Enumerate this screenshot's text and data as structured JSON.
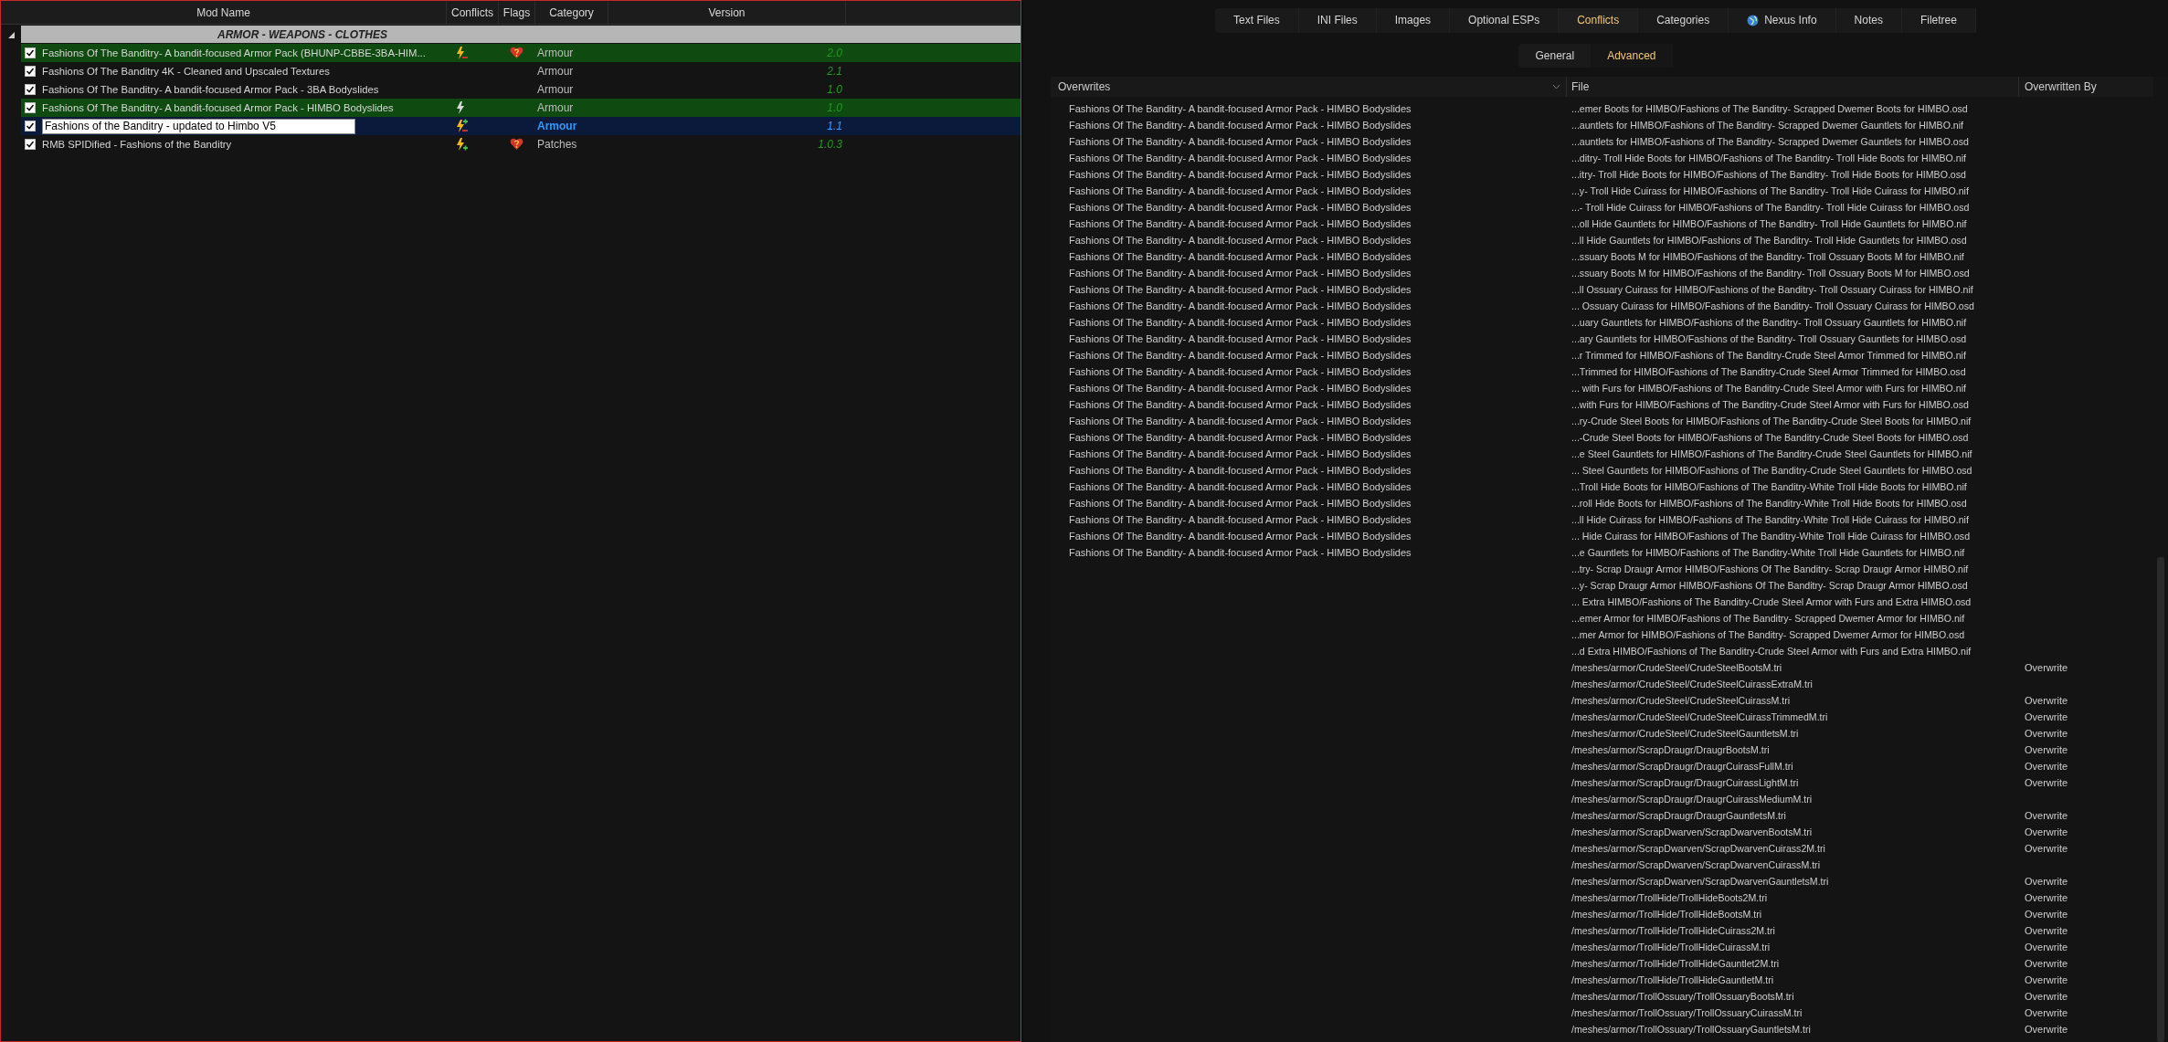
{
  "mod_list": {
    "columns": [
      "Mod Name",
      "Conflicts",
      "Flags",
      "Category",
      "Version"
    ],
    "group": {
      "label": "ARMOR - WEAPONS - CLOTHES",
      "expanded": true
    },
    "mods": [
      {
        "enabled": true,
        "name": "Fashions Of The Banditry- A bandit-focused Armor Pack (BHUNP-CBBE-3BA-HIM...",
        "overwrites": false,
        "overwritten": true,
        "redundant": false,
        "flagged": true,
        "category": "Armour",
        "version": "2.0",
        "highlighted": true,
        "selected": false,
        "editing": false
      },
      {
        "enabled": true,
        "name": "Fashions Of The Banditry 4K - Cleaned and Upscaled Textures",
        "category": "Armour",
        "version": "2.1",
        "highlighted": false,
        "selected": false,
        "editing": false
      },
      {
        "enabled": true,
        "name": "Fashions Of The Banditry- A bandit-focused Armor Pack - 3BA Bodyslides",
        "category": "Armour",
        "version": "1.0",
        "highlighted": false,
        "selected": false,
        "editing": false
      },
      {
        "enabled": true,
        "name": "Fashions Of The Banditry- A bandit-focused Armor Pack - HIMBO Bodyslides",
        "overwrites": false,
        "overwritten": false,
        "redundant": true,
        "category": "Armour",
        "version": "1.0",
        "highlighted": true,
        "selected": false,
        "editing": false
      },
      {
        "enabled": true,
        "name": "Fashions of the Banditry - updated to Himbo V5",
        "overwrites": true,
        "overwritten": true,
        "redundant": false,
        "category": "Armour",
        "version": "1.1",
        "highlighted": false,
        "selected": true,
        "editing": true
      },
      {
        "enabled": true,
        "name": "RMB SPIDified - Fashions of the Banditry",
        "overwrites": true,
        "overwritten": false,
        "redundant": false,
        "flagged": true,
        "category": "Patches",
        "version": "1.0.3",
        "highlighted": false,
        "selected": false,
        "editing": false
      }
    ]
  },
  "tabs": [
    {
      "label": "Text Files",
      "selected": false
    },
    {
      "label": "INI Files",
      "selected": false
    },
    {
      "label": "Images",
      "selected": false
    },
    {
      "label": "Optional ESPs",
      "selected": false
    },
    {
      "label": "Conflicts",
      "selected": true
    },
    {
      "label": "Categories",
      "selected": false
    },
    {
      "label": "Nexus Info",
      "selected": false,
      "kind": "globe"
    },
    {
      "label": "Notes",
      "selected": false
    },
    {
      "label": "Filetree",
      "selected": false
    }
  ],
  "subtabs": [
    {
      "label": "General",
      "selected": false
    },
    {
      "label": "Advanced",
      "selected": true
    }
  ],
  "conflicts_table": {
    "columns": [
      "Overwrites",
      "File",
      "Overwritten By"
    ],
    "rows": [
      {
        "overwrites": "Fashions Of The Banditry- A bandit-focused Armor Pack - HIMBO Bodyslides",
        "file": "...emer Boots for HIMBO/Fashions of The Banditry- Scrapped Dwemer Boots for HIMBO.osd"
      },
      {
        "overwrites": "Fashions Of The Banditry- A bandit-focused Armor Pack - HIMBO Bodyslides",
        "file": "...auntlets for HIMBO/Fashions of The Banditry- Scrapped Dwemer Gauntlets for HIMBO.nif"
      },
      {
        "overwrites": "Fashions Of The Banditry- A bandit-focused Armor Pack - HIMBO Bodyslides",
        "file": "...auntlets for HIMBO/Fashions of The Banditry- Scrapped Dwemer Gauntlets for HIMBO.osd"
      },
      {
        "overwrites": "Fashions Of The Banditry- A bandit-focused Armor Pack - HIMBO Bodyslides",
        "file": "...ditry- Troll Hide Boots for HIMBO/Fashions of The Banditry- Troll Hide Boots for HIMBO.nif"
      },
      {
        "overwrites": "Fashions Of The Banditry- A bandit-focused Armor Pack - HIMBO Bodyslides",
        "file": "...itry- Troll Hide Boots for HIMBO/Fashions of The Banditry- Troll Hide Boots for HIMBO.osd"
      },
      {
        "overwrites": "Fashions Of The Banditry- A bandit-focused Armor Pack - HIMBO Bodyslides",
        "file": "...y- Troll Hide Cuirass for HIMBO/Fashions of The Banditry- Troll Hide Cuirass for HIMBO.nif"
      },
      {
        "overwrites": "Fashions Of The Banditry- A bandit-focused Armor Pack - HIMBO Bodyslides",
        "file": "...- Troll Hide Cuirass for HIMBO/Fashions of The Banditry- Troll Hide Cuirass for HIMBO.osd"
      },
      {
        "overwrites": "Fashions Of The Banditry- A bandit-focused Armor Pack - HIMBO Bodyslides",
        "file": "...oll Hide Gauntlets for HIMBO/Fashions of The Banditry- Troll Hide Gauntlets for HIMBO.nif"
      },
      {
        "overwrites": "Fashions Of The Banditry- A bandit-focused Armor Pack - HIMBO Bodyslides",
        "file": "...ll Hide Gauntlets for HIMBO/Fashions of The Banditry- Troll Hide Gauntlets for HIMBO.osd"
      },
      {
        "overwrites": "Fashions Of The Banditry- A bandit-focused Armor Pack - HIMBO Bodyslides",
        "file": "...ssuary Boots M for HIMBO/Fashions of the Banditry- Troll Ossuary Boots M for HIMBO.nif"
      },
      {
        "overwrites": "Fashions Of The Banditry- A bandit-focused Armor Pack - HIMBO Bodyslides",
        "file": "...ssuary Boots M for HIMBO/Fashions of the Banditry- Troll Ossuary Boots M for HIMBO.osd"
      },
      {
        "overwrites": "Fashions Of The Banditry- A bandit-focused Armor Pack - HIMBO Bodyslides",
        "file": "...ll Ossuary Cuirass for HIMBO/Fashions of the Banditry- Troll Ossuary Cuirass for HIMBO.nif"
      },
      {
        "overwrites": "Fashions Of The Banditry- A bandit-focused Armor Pack - HIMBO Bodyslides",
        "file": "... Ossuary Cuirass for HIMBO/Fashions of the Banditry- Troll Ossuary Cuirass for HIMBO.osd"
      },
      {
        "overwrites": "Fashions Of The Banditry- A bandit-focused Armor Pack - HIMBO Bodyslides",
        "file": "...uary Gauntlets for HIMBO/Fashions of the Banditry- Troll Ossuary Gauntlets for HIMBO.nif"
      },
      {
        "overwrites": "Fashions Of The Banditry- A bandit-focused Armor Pack - HIMBO Bodyslides",
        "file": "...ary Gauntlets for HIMBO/Fashions of the Banditry- Troll Ossuary Gauntlets for HIMBO.osd"
      },
      {
        "overwrites": "Fashions Of The Banditry- A bandit-focused Armor Pack - HIMBO Bodyslides",
        "file": "...r Trimmed for HIMBO/Fashions of The Banditry-Crude Steel Armor Trimmed for HIMBO.nif"
      },
      {
        "overwrites": "Fashions Of The Banditry- A bandit-focused Armor Pack - HIMBO Bodyslides",
        "file": "...Trimmed for HIMBO/Fashions of The Banditry-Crude Steel Armor Trimmed for HIMBO.osd"
      },
      {
        "overwrites": "Fashions Of The Banditry- A bandit-focused Armor Pack - HIMBO Bodyslides",
        "file": "... with Furs for HIMBO/Fashions of The Banditry-Crude Steel Armor with Furs for HIMBO.nif"
      },
      {
        "overwrites": "Fashions Of The Banditry- A bandit-focused Armor Pack - HIMBO Bodyslides",
        "file": "...with Furs for HIMBO/Fashions of The Banditry-Crude Steel Armor with Furs for HIMBO.osd"
      },
      {
        "overwrites": "Fashions Of The Banditry- A bandit-focused Armor Pack - HIMBO Bodyslides",
        "file": "...ry-Crude Steel Boots for HIMBO/Fashions of The Banditry-Crude Steel Boots for HIMBO.nif"
      },
      {
        "overwrites": "Fashions Of The Banditry- A bandit-focused Armor Pack - HIMBO Bodyslides",
        "file": "...-Crude Steel Boots for HIMBO/Fashions of The Banditry-Crude Steel Boots for HIMBO.osd"
      },
      {
        "overwrites": "Fashions Of The Banditry- A bandit-focused Armor Pack - HIMBO Bodyslides",
        "file": "...e Steel Gauntlets for HIMBO/Fashions of The Banditry-Crude Steel Gauntlets for HIMBO.nif"
      },
      {
        "overwrites": "Fashions Of The Banditry- A bandit-focused Armor Pack - HIMBO Bodyslides",
        "file": "... Steel Gauntlets for HIMBO/Fashions of The Banditry-Crude Steel Gauntlets for HIMBO.osd"
      },
      {
        "overwrites": "Fashions Of The Banditry- A bandit-focused Armor Pack - HIMBO Bodyslides",
        "file": "...Troll Hide Boots for HIMBO/Fashions of The Banditry-White Troll Hide Boots for HIMBO.nif"
      },
      {
        "overwrites": "Fashions Of The Banditry- A bandit-focused Armor Pack - HIMBO Bodyslides",
        "file": "...roll Hide Boots for HIMBO/Fashions of The Banditry-White Troll Hide Boots for HIMBO.osd"
      },
      {
        "overwrites": "Fashions Of The Banditry- A bandit-focused Armor Pack - HIMBO Bodyslides",
        "file": "...ll Hide Cuirass for HIMBO/Fashions of The Banditry-White Troll Hide Cuirass for HIMBO.nif"
      },
      {
        "overwrites": "Fashions Of The Banditry- A bandit-focused Armor Pack - HIMBO Bodyslides",
        "file": "... Hide Cuirass for HIMBO/Fashions of The Banditry-White Troll Hide Cuirass for HIMBO.osd"
      },
      {
        "overwrites": "Fashions Of The Banditry- A bandit-focused Armor Pack - HIMBO Bodyslides",
        "file": "...e Gauntlets for HIMBO/Fashions of The Banditry-White Troll Hide Gauntlets for HIMBO.nif"
      },
      {
        "file": "...try- Scrap Draugr Armor HIMBO/Fashions Of The Banditry- Scrap Draugr Armor HIMBO.nif"
      },
      {
        "file": "...y- Scrap Draugr Armor HIMBO/Fashions Of The Banditry- Scrap Draugr Armor HIMBO.osd"
      },
      {
        "file": "... Extra HIMBO/Fashions of The Banditry-Crude Steel Armor with Furs and Extra HIMBO.osd"
      },
      {
        "file": "...emer Armor for HIMBO/Fashions of The Banditry- Scrapped Dwemer Armor for HIMBO.nif"
      },
      {
        "file": "...mer Armor for HIMBO/Fashions of The Banditry- Scrapped Dwemer Armor for HIMBO.osd"
      },
      {
        "file": "...d Extra HIMBO/Fashions of The Banditry-Crude Steel Armor with Furs and Extra HIMBO.nif"
      },
      {
        "file": "/meshes/armor/CrudeSteel/CrudeSteelBootsM.tri",
        "overwritten_by": "Overwrite"
      },
      {
        "file": "/meshes/armor/CrudeSteel/CrudeSteelCuirassExtraM.tri"
      },
      {
        "file": "/meshes/armor/CrudeSteel/CrudeSteelCuirassM.tri",
        "overwritten_by": "Overwrite"
      },
      {
        "file": "/meshes/armor/CrudeSteel/CrudeSteelCuirassTrimmedM.tri",
        "overwritten_by": "Overwrite"
      },
      {
        "file": "/meshes/armor/CrudeSteel/CrudeSteelGauntletsM.tri",
        "overwritten_by": "Overwrite"
      },
      {
        "file": "/meshes/armor/ScrapDraugr/DraugrBootsM.tri",
        "overwritten_by": "Overwrite"
      },
      {
        "file": "/meshes/armor/ScrapDraugr/DraugrCuirassFullM.tri",
        "overwritten_by": "Overwrite"
      },
      {
        "file": "/meshes/armor/ScrapDraugr/DraugrCuirassLightM.tri",
        "overwritten_by": "Overwrite"
      },
      {
        "file": "/meshes/armor/ScrapDraugr/DraugrCuirassMediumM.tri"
      },
      {
        "file": "/meshes/armor/ScrapDraugr/DraugrGauntletsM.tri",
        "overwritten_by": "Overwrite"
      },
      {
        "file": "/meshes/armor/ScrapDwarven/ScrapDwarvenBootsM.tri",
        "overwritten_by": "Overwrite"
      },
      {
        "file": "/meshes/armor/ScrapDwarven/ScrapDwarvenCuirass2M.tri",
        "overwritten_by": "Overwrite"
      },
      {
        "file": "/meshes/armor/ScrapDwarven/ScrapDwarvenCuirassM.tri"
      },
      {
        "file": "/meshes/armor/ScrapDwarven/ScrapDwarvenGauntletsM.tri",
        "overwritten_by": "Overwrite"
      },
      {
        "file": "/meshes/armor/TrollHide/TrollHideBoots2M.tri",
        "overwritten_by": "Overwrite"
      },
      {
        "file": "/meshes/armor/TrollHide/TrollHideBootsM.tri",
        "overwritten_by": "Overwrite"
      },
      {
        "file": "/meshes/armor/TrollHide/TrollHideCuirass2M.tri",
        "overwritten_by": "Overwrite"
      },
      {
        "file": "/meshes/armor/TrollHide/TrollHideCuirassM.tri",
        "overwritten_by": "Overwrite"
      },
      {
        "file": "/meshes/armor/TrollHide/TrollHideGauntlet2M.tri",
        "overwritten_by": "Overwrite"
      },
      {
        "file": "/meshes/armor/TrollHide/TrollHideGauntletM.tri",
        "overwritten_by": "Overwrite"
      },
      {
        "file": "/meshes/armor/TrollOssuary/TrollOssuaryBootsM.tri",
        "overwritten_by": "Overwrite"
      },
      {
        "file": "/meshes/armor/TrollOssuary/TrollOssuaryCuirassM.tri",
        "overwritten_by": "Overwrite"
      },
      {
        "file": "/meshes/armor/TrollOssuary/TrollOssuaryGauntletsM.tri",
        "overwritten_by": "Overwrite"
      }
    ]
  }
}
